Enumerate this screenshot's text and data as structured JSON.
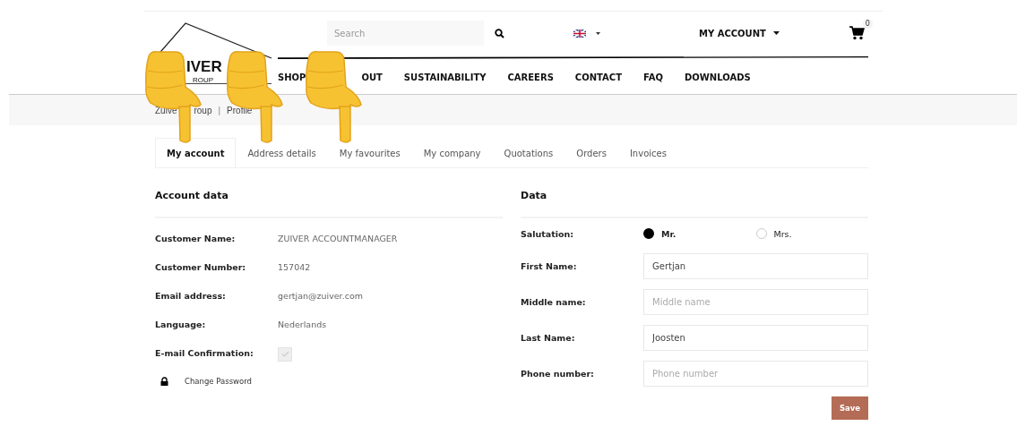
{
  "header": {
    "logo": {
      "name": "IVER",
      "tagline": "ROUP"
    },
    "search": {
      "placeholder": "Search"
    },
    "account_menu": "MY ACCOUNT",
    "cart": {
      "count": "0"
    }
  },
  "nav": [
    "SHOP",
    "OUT",
    "SUSTAINABILITY",
    "CAREERS",
    "CONTACT",
    "FAQ",
    "DOWNLOADS"
  ],
  "breadcrumb": {
    "items": [
      "Zuive",
      "roup"
    ],
    "separator": "|",
    "current": "Profile"
  },
  "tabs": [
    {
      "label": "My account",
      "selected": true
    },
    {
      "label": "Address details",
      "selected": false
    },
    {
      "label": "My favourites",
      "selected": false
    },
    {
      "label": "My company",
      "selected": false
    },
    {
      "label": "Quotations",
      "selected": false
    },
    {
      "label": "Orders",
      "selected": false
    },
    {
      "label": "Invoices",
      "selected": false
    }
  ],
  "account_data": {
    "title": "Account data",
    "rows": [
      {
        "kind": "text",
        "label": "Customer Name:",
        "value": "ZUIVER ACCOUNTMANAGER"
      },
      {
        "kind": "text",
        "label": "Customer Number:",
        "value": "157042"
      },
      {
        "kind": "text",
        "label": "Email address:",
        "value": "gertjan@zuiver.com"
      },
      {
        "kind": "text",
        "label": "Language:",
        "value": "Nederlands"
      },
      {
        "kind": "checkbox",
        "label": "E-mail Confirmation:",
        "checked": true
      }
    ],
    "change_password": "Change Password"
  },
  "data": {
    "title": "Data",
    "salutation": {
      "label": "Salutation:",
      "options": [
        {
          "label": "Mr.",
          "selected": true
        },
        {
          "label": "Mrs.",
          "selected": false
        }
      ]
    },
    "fields": [
      {
        "label": "First Name:",
        "value": "Gertjan"
      },
      {
        "label": "Middle name:",
        "placeholder": "Middle name"
      },
      {
        "label": "Last Name:",
        "value": "Joosten"
      },
      {
        "label": "Phone number:",
        "placeholder": "Phone number"
      }
    ],
    "save": "Save"
  }
}
